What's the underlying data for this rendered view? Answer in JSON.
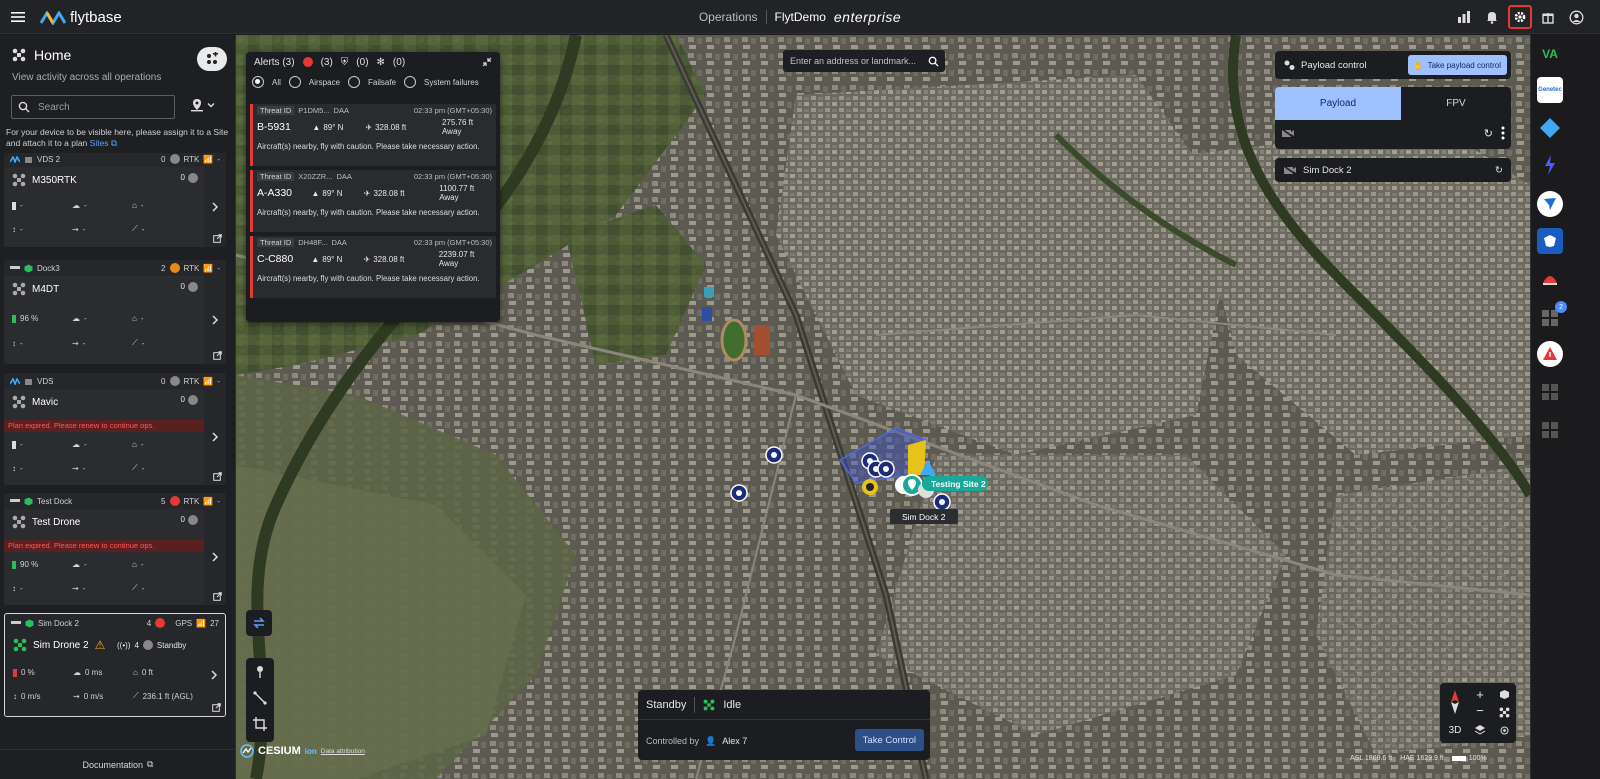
{
  "topbar": {
    "brand": "flytbase",
    "section": "Operations",
    "org": "FlytDemo",
    "edition": "enterprise",
    "icons": [
      "analytics-icon",
      "bell-icon",
      "gear-icon",
      "gift-icon",
      "user-icon"
    ]
  },
  "home": {
    "title": "Home",
    "subtitle": "View activity across all operations",
    "search_placeholder": "Search",
    "hint": "For your device to be visible here, please assign it to a Site and attach it to a plan",
    "sites_link": "Sites"
  },
  "devices": [
    {
      "site": "VDS 2",
      "site_count": "0",
      "link": "RTK",
      "drone": "M350RTK",
      "drone_count": "0",
      "battery": "-",
      "wind": "-",
      "home": "-",
      "alt": "-",
      "speed": "-",
      "dist": "-",
      "expired": ""
    },
    {
      "site": "Dock3",
      "site_count": "2",
      "link": "RTK",
      "drone": "M4DT",
      "drone_count": "0",
      "battery": "96 %",
      "wind": "-",
      "home": "-",
      "alt": "-",
      "speed": "-",
      "dist": "-",
      "expired": ""
    },
    {
      "site": "VDS",
      "site_count": "0",
      "link": "RTK",
      "drone": "Mavic",
      "drone_count": "0",
      "battery": "-",
      "wind": "-",
      "home": "-",
      "alt": "-",
      "speed": "-",
      "dist": "-",
      "expired": "Plan expired. Please renew to continue ops."
    },
    {
      "site": "Test Dock",
      "site_count": "5",
      "link": "RTK",
      "drone": "Test Drone",
      "drone_count": "0",
      "battery": "90 %",
      "wind": "-",
      "home": "-",
      "alt": "-",
      "speed": "-",
      "dist": "-",
      "expired": "Plan expired. Please renew to continue ops."
    },
    {
      "site": "Sim Dock 2",
      "site_count": "4",
      "link": "GPS",
      "link_count": "27",
      "drone": "Sim Drone 2",
      "drone_count": "4",
      "state": "Standby",
      "battery": "0 %",
      "wind": "0 ms",
      "home": "0 ft",
      "alt": "0 m/s",
      "speed": "0 m/s",
      "dist": "236.1 ft (AGL)",
      "expired": ""
    }
  ],
  "documentation": "Documentation",
  "alerts": {
    "title": "Alerts (3)",
    "counts": [
      "(3)",
      "(0)",
      "(0)"
    ],
    "filters": [
      "All",
      "Airspace",
      "Failsafe",
      "System failures"
    ],
    "items": [
      {
        "threat_label": "Threat ID",
        "threat_id": "P1DM5...",
        "type": "DAA",
        "time": "02:33 pm (GMT+05:30)",
        "callsign": "B-5931",
        "heading": "89° N",
        "altitude": "328.08 ft",
        "distance": "275.76 ft Away",
        "message": "Aircraft(s) nearby, fly with caution. Please take necessary action."
      },
      {
        "threat_label": "Threat ID",
        "threat_id": "X20ZZR...",
        "type": "DAA",
        "time": "02:33 pm (GMT+05:30)",
        "callsign": "A-A330",
        "heading": "89° N",
        "altitude": "328.08 ft",
        "distance": "1100.77 ft Away",
        "message": "Aircraft(s) nearby, fly with caution. Please take necessary action."
      },
      {
        "threat_label": "Threat ID",
        "threat_id": "DH48F...",
        "type": "DAA",
        "time": "02:33 pm (GMT+05:30)",
        "callsign": "C-C880",
        "heading": "89° N",
        "altitude": "328.08 ft",
        "distance": "2239.07 ft Away",
        "message": "Aircraft(s) nearby, fly with caution. Please take necessary action."
      }
    ]
  },
  "map": {
    "search_placeholder": "Enter an address or landmark...",
    "site_label": "Testing Site 2",
    "dock_label": "Sim Dock 2",
    "cesium": "CESIUM",
    "cesium_sub": "ion",
    "attribution": "Data attribution",
    "asl": "ASL 1869.6 ft",
    "hae": "HAE 1629.9 ft",
    "zoom": "100%",
    "mode_3d": "3D"
  },
  "payload": {
    "control_label": "Payload control",
    "take_label": "Take payload control",
    "tabs": [
      "Payload",
      "FPV"
    ],
    "dock": "Sim Dock 2"
  },
  "status": {
    "mode": "Standby",
    "state": "Idle",
    "controlled_by_label": "Controlled by",
    "controller": "Alex 7",
    "take_control": "Take Control"
  },
  "rail": {
    "badge": "2"
  }
}
